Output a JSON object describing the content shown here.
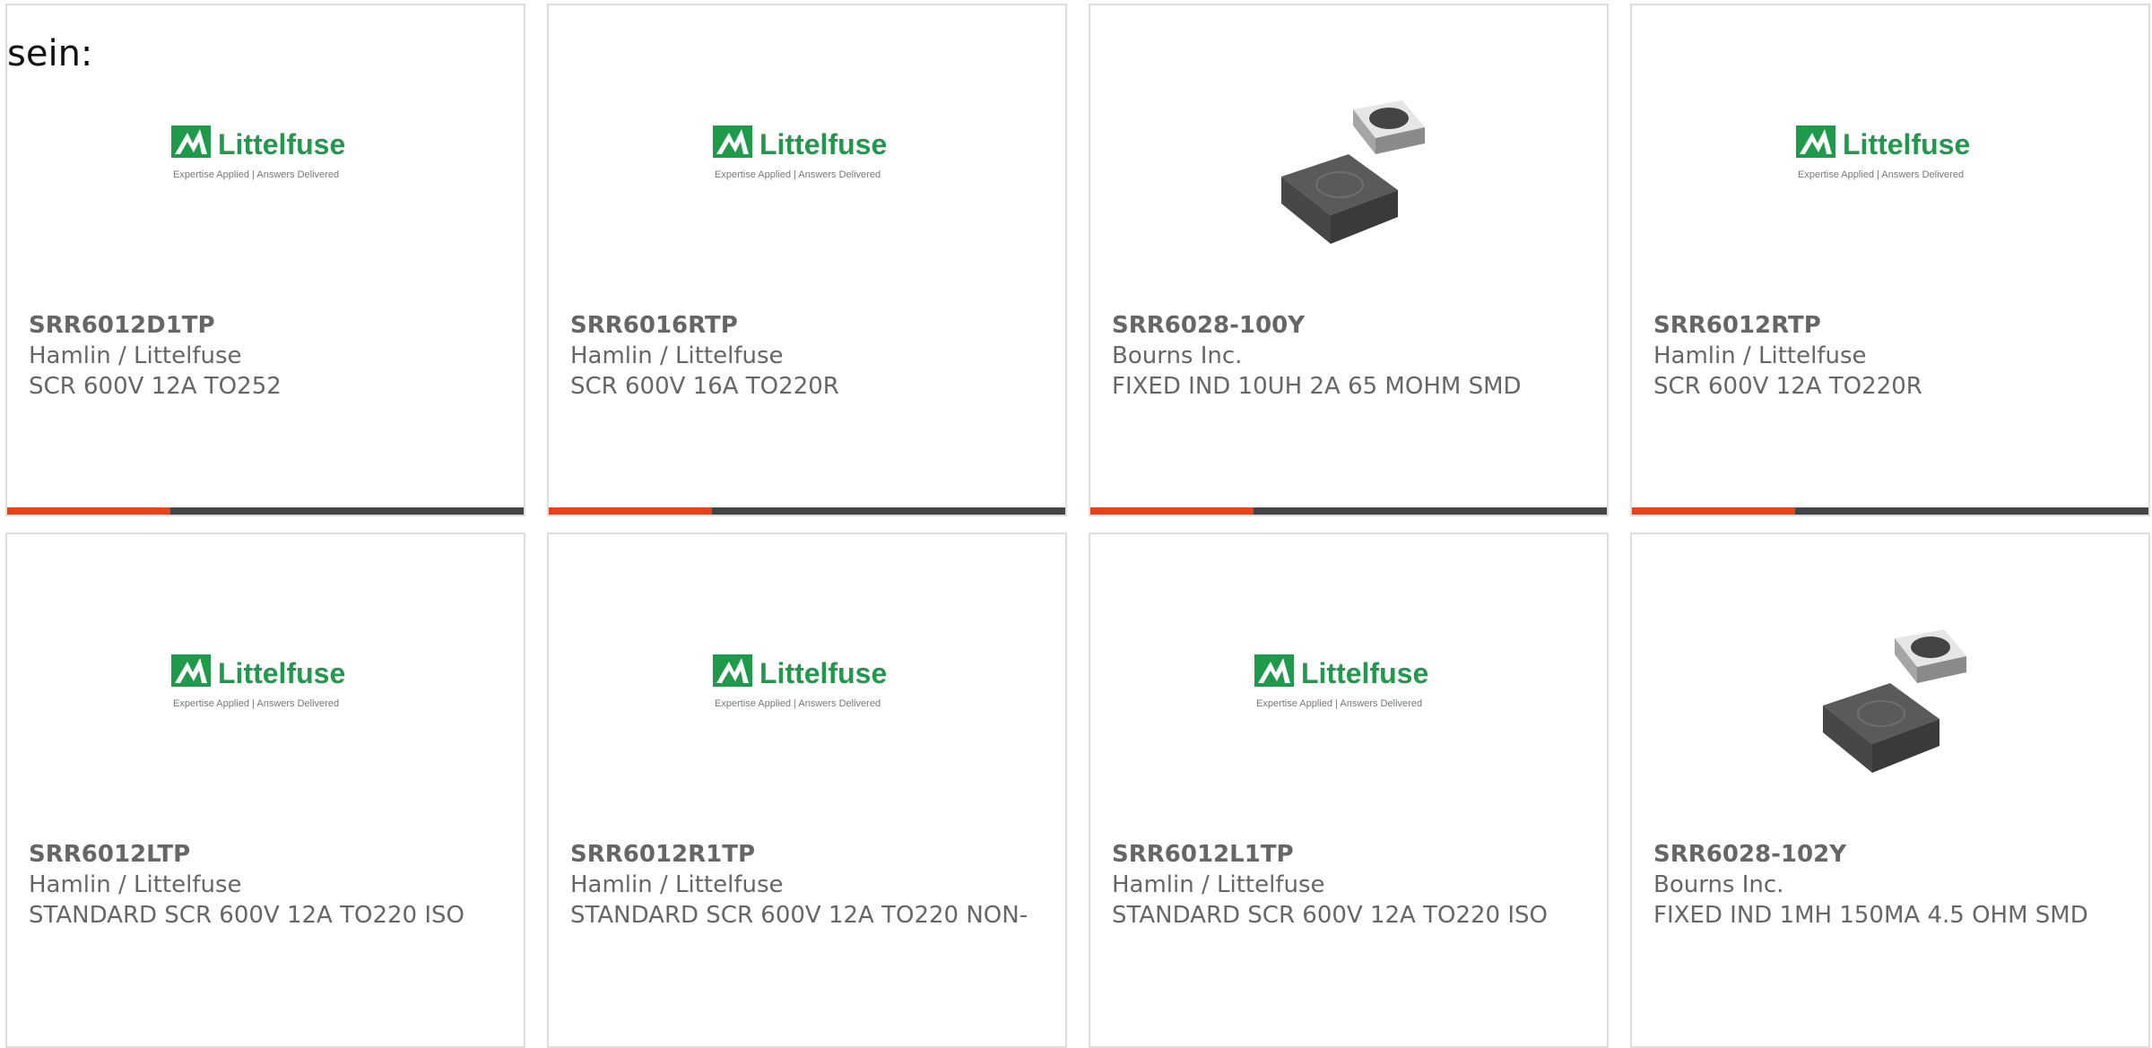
{
  "intro_text": "sein:",
  "logo": {
    "brand_text": "Littelfuse",
    "tagline_left": "Expertise Applied",
    "tagline_right": "Answers Delivered",
    "brand_color": "#1f9a4b"
  },
  "colors": {
    "accent": "#e8441c",
    "bar": "#444444",
    "text": "#666666",
    "border": "#dddddd"
  },
  "products": [
    {
      "part_number": "SRR6012D1TP",
      "manufacturer": "Hamlin / Littelfuse",
      "description": "SCR 600V 12A TO252",
      "image": "littelfuse-logo"
    },
    {
      "part_number": "SRR6016RTP",
      "manufacturer": "Hamlin / Littelfuse",
      "description": "SCR 600V 16A TO220R",
      "image": "littelfuse-logo"
    },
    {
      "part_number": "SRR6028-100Y",
      "manufacturer": "Bourns Inc.",
      "description": "FIXED IND 10UH 2A 65 MOHM SMD",
      "image": "inductor-photo"
    },
    {
      "part_number": "SRR6012RTP",
      "manufacturer": "Hamlin / Littelfuse",
      "description": "SCR 600V 12A TO220R",
      "image": "littelfuse-logo"
    },
    {
      "part_number": "SRR6012LTP",
      "manufacturer": "Hamlin / Littelfuse",
      "description": "STANDARD SCR 600V 12A TO220 ISO",
      "image": "littelfuse-logo"
    },
    {
      "part_number": "SRR6012R1TP",
      "manufacturer": "Hamlin / Littelfuse",
      "description": "STANDARD SCR 600V 12A TO220 NON-",
      "image": "littelfuse-logo"
    },
    {
      "part_number": "SRR6012L1TP",
      "manufacturer": "Hamlin / Littelfuse",
      "description": "STANDARD SCR 600V 12A TO220 ISO",
      "image": "littelfuse-logo"
    },
    {
      "part_number": "SRR6028-102Y",
      "manufacturer": "Bourns Inc.",
      "description": "FIXED IND 1MH 150MA 4.5 OHM SMD",
      "image": "inductor-photo"
    }
  ]
}
